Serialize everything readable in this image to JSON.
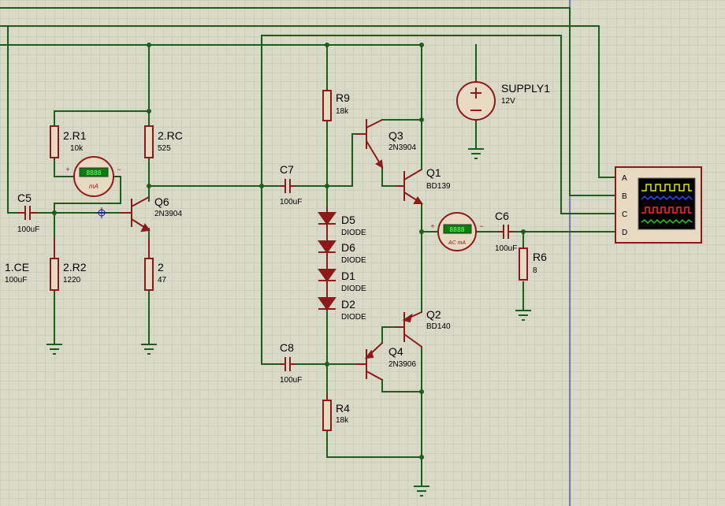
{
  "colors": {
    "background": "#d9d9c7",
    "grid": "#c4c4b0",
    "wire": "#1f5c1f",
    "component": "#8b1a1a",
    "component_fill": "#e8d9c3",
    "meter_display": "#0b7d0b",
    "scope_screen": "#000000",
    "border_line": "#1a1aa0"
  },
  "components": {
    "c5": {
      "ref": "C5",
      "value": "100uF"
    },
    "ce": {
      "ref": "1.CE",
      "value": "100uF"
    },
    "r1": {
      "ref": "2.R1",
      "value": "10k"
    },
    "r2": {
      "ref": "2.R2",
      "value": "1220"
    },
    "rc": {
      "ref": "2.RC",
      "value": "525"
    },
    "re": {
      "ref": "2",
      "value": "47"
    },
    "q6": {
      "ref": "Q6",
      "value": "2N3904"
    },
    "c7": {
      "ref": "C7",
      "value": "100uF"
    },
    "c8": {
      "ref": "C8",
      "value": "100uF"
    },
    "r9": {
      "ref": "R9",
      "value": "18k"
    },
    "r4": {
      "ref": "R4",
      "value": "18k"
    },
    "d5": {
      "ref": "D5",
      "value": "DIODE"
    },
    "d6": {
      "ref": "D6",
      "value": "DIODE"
    },
    "d1": {
      "ref": "D1",
      "value": "DIODE"
    },
    "d2": {
      "ref": "D2",
      "value": "DIODE"
    },
    "q3": {
      "ref": "Q3",
      "value": "2N3904"
    },
    "q1": {
      "ref": "Q1",
      "value": "BD139"
    },
    "q2": {
      "ref": "Q2",
      "value": "BD140"
    },
    "q4": {
      "ref": "Q4",
      "value": "2N3906"
    },
    "supply": {
      "ref": "SUPPLY1",
      "value": "12V"
    },
    "c6": {
      "ref": "C6",
      "value": "100uF"
    },
    "r6": {
      "ref": "R6",
      "value": "8"
    }
  },
  "meters": {
    "dc_ma": {
      "unit": "mA",
      "reading": "8888"
    },
    "ac_ma": {
      "unit": "AC mA",
      "reading": "8888"
    }
  },
  "oscilloscope": {
    "channels": [
      "A",
      "B",
      "C",
      "D"
    ],
    "trace_colors": [
      "#e6e600",
      "#2b4bff",
      "#ff2a2a",
      "#22cc22"
    ]
  },
  "polarity": {
    "plus": "+",
    "minus": "−"
  }
}
